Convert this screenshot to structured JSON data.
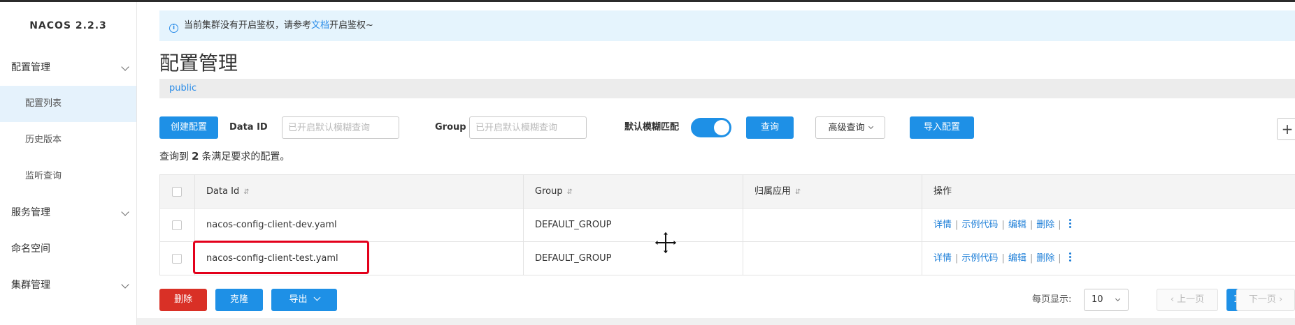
{
  "app": {
    "brand": "NACOS 2.2.3"
  },
  "sidebar": {
    "items": [
      {
        "label": "配置管理",
        "type": "group"
      },
      {
        "label": "配置列表",
        "type": "sub",
        "active": true
      },
      {
        "label": "历史版本",
        "type": "sub"
      },
      {
        "label": "监听查询",
        "type": "sub"
      },
      {
        "label": "服务管理",
        "type": "group"
      },
      {
        "label": "命名空间",
        "type": "item"
      },
      {
        "label": "集群管理",
        "type": "group"
      }
    ]
  },
  "notice": {
    "text_before": "当前集群没有开启鉴权，请参考",
    "link": "文档",
    "text_after": "开启鉴权~"
  },
  "page": {
    "title": "配置管理",
    "namespace": "public"
  },
  "search": {
    "create_button": "创建配置",
    "dataid_label": "Data ID",
    "dataid_placeholder": "已开启默认模糊查询",
    "group_label": "Group",
    "group_placeholder": "已开启默认模糊查询",
    "fuzzy_label": "默认模糊匹配",
    "fuzzy_on": true,
    "query_button": "查询",
    "advanced_button": "高级查询",
    "import_button": "导入配置",
    "plus_button": "+"
  },
  "result": {
    "prefix": "查询到",
    "count": "2",
    "suffix": "条满足要求的配置。"
  },
  "table": {
    "headers": [
      "Data Id",
      "Group",
      "归属应用",
      "操作"
    ],
    "sort_icon": "⇵",
    "rows": [
      {
        "dataId": "nacos-config-client-dev.yaml",
        "group": "DEFAULT_GROUP",
        "app": ""
      },
      {
        "dataId": "nacos-config-client-test.yaml",
        "group": "DEFAULT_GROUP",
        "app": ""
      }
    ],
    "actions": {
      "detail": "详情",
      "sample": "示例代码",
      "edit": "编辑",
      "delete": "删除",
      "sep": "|"
    }
  },
  "footer": {
    "delete_button": "删除",
    "clone_button": "克隆",
    "export_button": "导出",
    "page_size_label": "每页显示:",
    "page_size": "10",
    "prev": "上一页",
    "current_page": "1",
    "next": "下一页"
  },
  "colors": {
    "primary": "#1e90e6",
    "danger": "#d93026",
    "highlight": "#e3001b",
    "link": "#1e7fd8"
  }
}
